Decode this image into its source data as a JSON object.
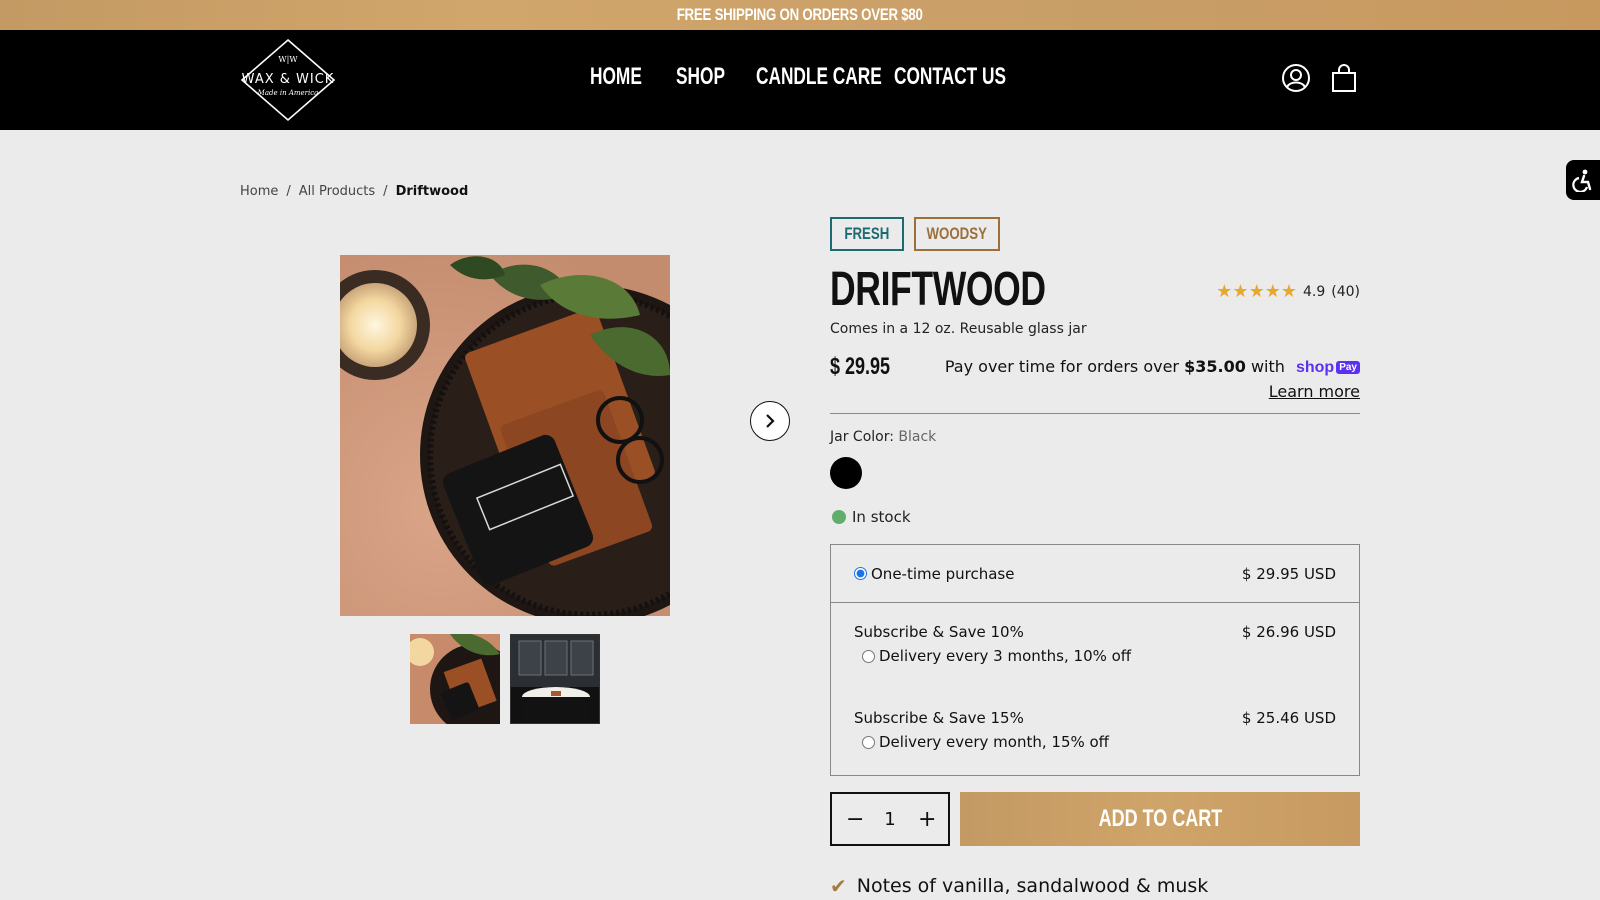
{
  "announcement": "FREE SHIPPING ON ORDERS OVER $80",
  "logo": {
    "brand": "WAX & WICK",
    "monogram": "W|W",
    "tagline": "Made in America"
  },
  "nav": {
    "home": "HOME",
    "shop": "SHOP",
    "candle_care": "CANDLE CARE",
    "contact": "CONTACT US"
  },
  "header_icons": [
    "account-icon",
    "cart-icon"
  ],
  "accessibility_icon": "accessibility-icon",
  "breadcrumb": {
    "home": "Home",
    "sep": "/",
    "all_products": "All Products",
    "current": "Driftwood"
  },
  "tags": {
    "fresh": "FRESH",
    "woodsy": "WOODSY"
  },
  "product": {
    "title": "DRIFTWOOD",
    "rating_value": "4.9",
    "rating_count": "(40)",
    "stars": 5,
    "subtitle": "Comes in a 12 oz. Reusable glass jar",
    "price": "$ 29.95"
  },
  "installments": {
    "text_before": "Pay over time for orders over",
    "amount": "$35.00",
    "text_after": "with",
    "brand": "shop",
    "brand_badge": "Pay",
    "learn_more": "Learn more"
  },
  "variant": {
    "label": "Jar Color:",
    "value": "Black",
    "swatch_color": "#000000"
  },
  "stock": {
    "text": "In stock",
    "color": "#5fae6b"
  },
  "purchase_options": {
    "one_time": {
      "label": "One-time purchase",
      "price": "$ 29.95 USD",
      "selected": true
    },
    "sub10": {
      "title": "Subscribe & Save 10%",
      "price": "$ 26.96 USD",
      "option": "Delivery every 3 months, 10% off"
    },
    "sub15": {
      "title": "Subscribe & Save 15%",
      "price": "$ 25.46 USD",
      "option": "Delivery every month, 15% off"
    }
  },
  "quantity": {
    "minus": "−",
    "value": "1",
    "plus": "+"
  },
  "add_to_cart": "ADD TO CART",
  "notes": "Notes of vanilla, sandalwood & musk",
  "colors": {
    "accent_gold": "#c69c64",
    "fresh": "#1b6b72",
    "woodsy": "#9c6f3b",
    "header": "#000000"
  }
}
